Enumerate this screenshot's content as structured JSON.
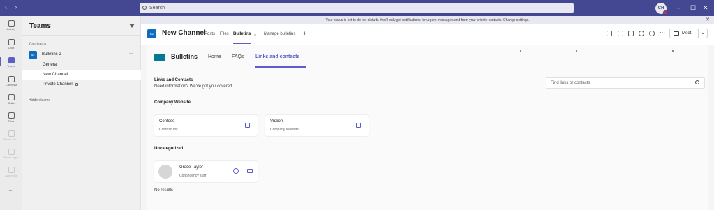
{
  "titlebar": {
    "search_placeholder": "Search",
    "avatar_initials": "CH",
    "window_controls": [
      "–",
      "☐",
      "✕"
    ]
  },
  "rail": {
    "items": [
      {
        "label": "Activity",
        "icon": "bell-icon"
      },
      {
        "label": "Chat",
        "icon": "chat-icon"
      },
      {
        "label": "Teams",
        "icon": "teams-icon"
      },
      {
        "label": "Calendar",
        "icon": "calendar-icon"
      },
      {
        "label": "Calls",
        "icon": "phone-icon"
      },
      {
        "label": "Files",
        "icon": "file-icon"
      },
      {
        "label": "Power Aut...",
        "icon": "power-automate-icon"
      },
      {
        "label": "Power Apps",
        "icon": "power-apps-icon"
      },
      {
        "label": "Approvals",
        "icon": "approvals-icon"
      }
    ],
    "more": "..."
  },
  "teams_pane": {
    "title": "Teams",
    "your_teams_label": "Your teams",
    "team": {
      "badge": "B2",
      "name": "Bulletins 2",
      "more": "..."
    },
    "channels": [
      "General",
      "New Channel",
      "Private Channel"
    ],
    "hidden_teams_label": "Hidden teams"
  },
  "banner": {
    "text": "Your status is set to do not disturb. You'll only get notifications for urgent messages and from your priority contacts.",
    "link": "Change settings."
  },
  "channel_bar": {
    "badge": "B2",
    "title": "New Channel",
    "tabs": [
      "Posts",
      "Files",
      "Bulletins",
      "Manage bulletins",
      "+"
    ],
    "meet_label": "Meet"
  },
  "app": {
    "name": "Bulletins",
    "tabs": [
      "Home",
      "FAQs",
      "Links and contacts"
    ],
    "active_tab": "Links and contacts"
  },
  "links": {
    "heading": "Links and Contacts",
    "subheading": "Need information? We've got you covered.",
    "search_placeholder": "Find links or contacts",
    "company_section": "Company Website",
    "cards": [
      {
        "title": "Contoso",
        "subtitle": "Contoso Inc."
      },
      {
        "title": "Vuzion",
        "subtitle": "Company Website"
      }
    ],
    "uncategorized_section": "Uncategorized",
    "person": {
      "name": "Grace Taylor",
      "role": "Contingency staff"
    },
    "no_results": "No results"
  }
}
